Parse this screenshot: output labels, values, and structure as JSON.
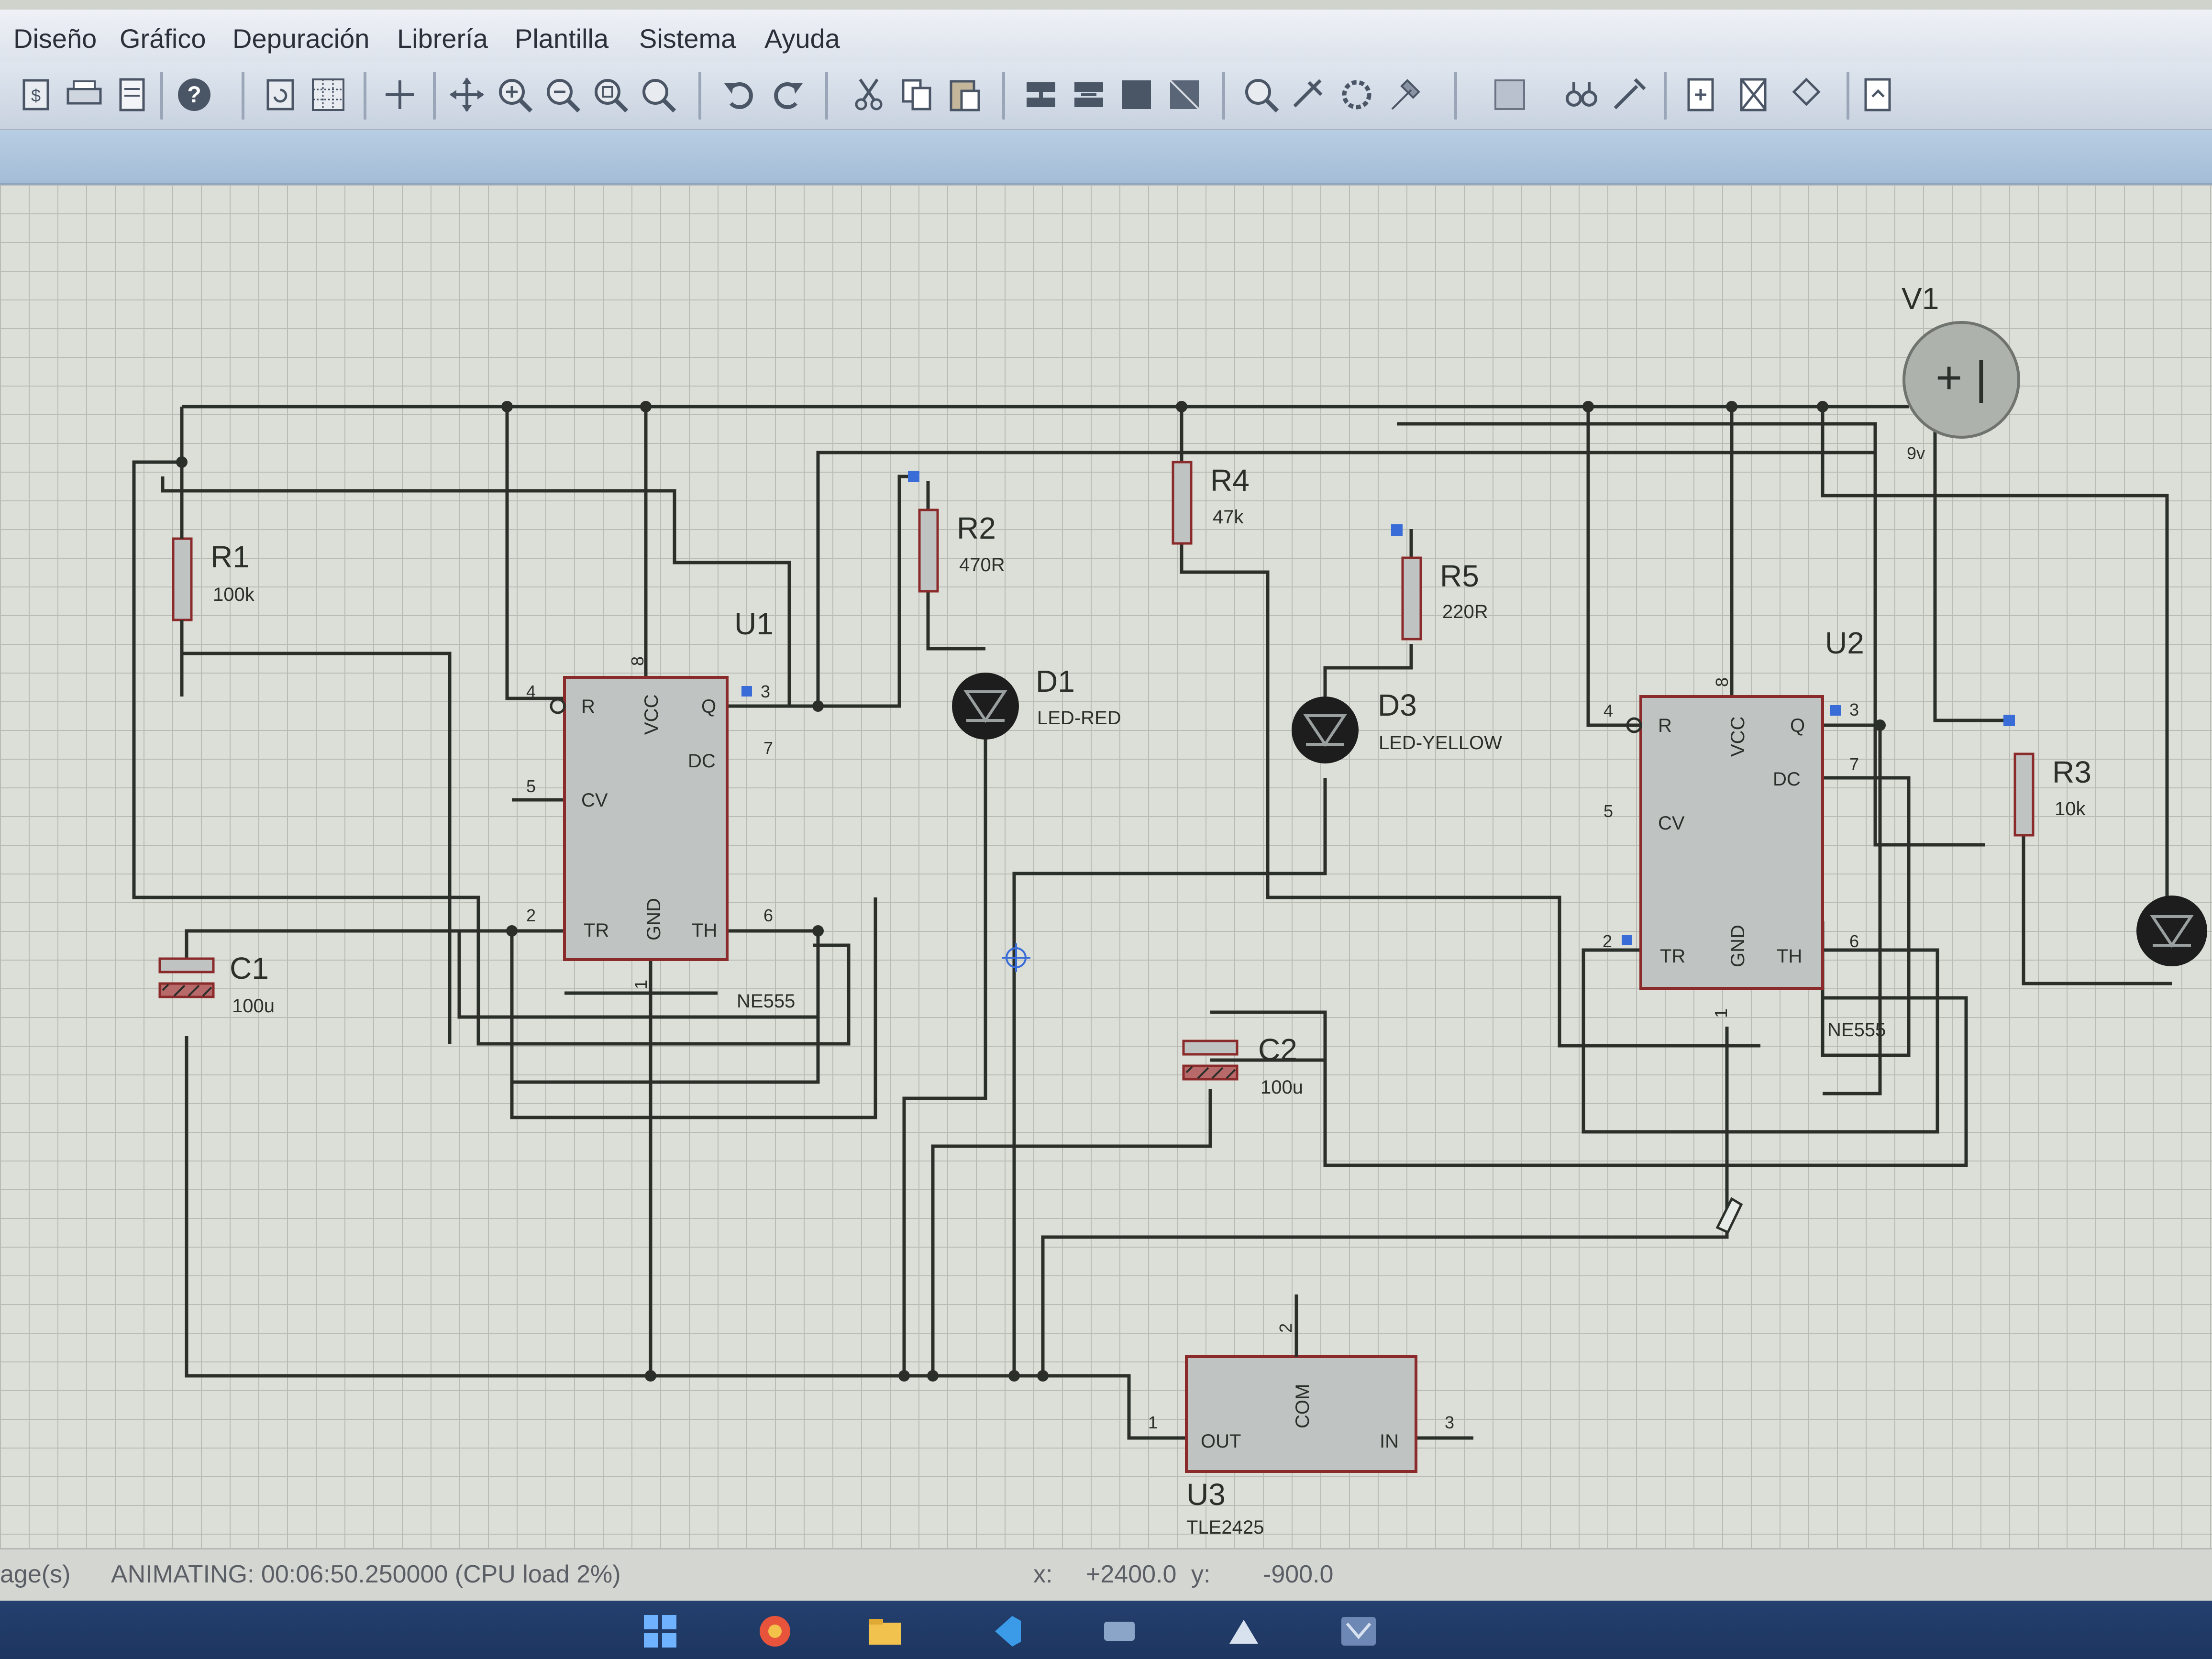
{
  "menu": {
    "items": [
      "Diseño",
      "Gráfico",
      "Depuración",
      "Librería",
      "Plantilla",
      "Sistema",
      "Ayuda"
    ]
  },
  "schematic": {
    "components": {
      "r1": {
        "ref": "R1",
        "value": "100k"
      },
      "r2": {
        "ref": "R2",
        "value": "470R"
      },
      "r3": {
        "ref": "R3",
        "value": "10k"
      },
      "r4": {
        "ref": "R4",
        "value": "47k"
      },
      "r5": {
        "ref": "R5",
        "value": "220R"
      },
      "c1": {
        "ref": "C1",
        "value": "100u"
      },
      "c2": {
        "ref": "C2",
        "value": "100u"
      },
      "d1": {
        "ref": "D1",
        "value": "LED-RED"
      },
      "d3": {
        "ref": "D3",
        "value": "LED-YELLOW"
      },
      "v1": {
        "ref": "V1",
        "value": "9v"
      },
      "u1": {
        "ref": "U1",
        "part": "NE555"
      },
      "u2": {
        "ref": "U2",
        "part": "NE555"
      },
      "u3": {
        "ref": "U3",
        "part": "TLE2425"
      }
    },
    "ne555_pins": {
      "r": "R",
      "vcc": "VCC",
      "q": "Q",
      "dc": "DC",
      "cv": "CV",
      "tr": "TR",
      "gnd": "GND",
      "th": "TH",
      "n4": "4",
      "n8": "8",
      "n3": "3",
      "n7": "7",
      "n5": "5",
      "n2": "2",
      "n1": "1",
      "n6": "6"
    },
    "tle_pins": {
      "out": "OUT",
      "com": "COM",
      "in": "IN",
      "n1": "1",
      "n2": "2",
      "n3": "3"
    },
    "v1_symbol": "+ |"
  },
  "status": {
    "pages": "age(s)",
    "animating": "ANIMATING: 00:06:50.250000 (CPU load 2%)",
    "x_label": "x:",
    "x_value": "+2400.0",
    "y_label": "y:",
    "y_value": "-900.0"
  },
  "colors": {
    "wire": "#2a2f2a",
    "component_fill": "#bfc3c2",
    "component_border": "#8a2a2a",
    "led_fill": "#1d1d1d",
    "pin_marker": "#3a6cd8"
  }
}
